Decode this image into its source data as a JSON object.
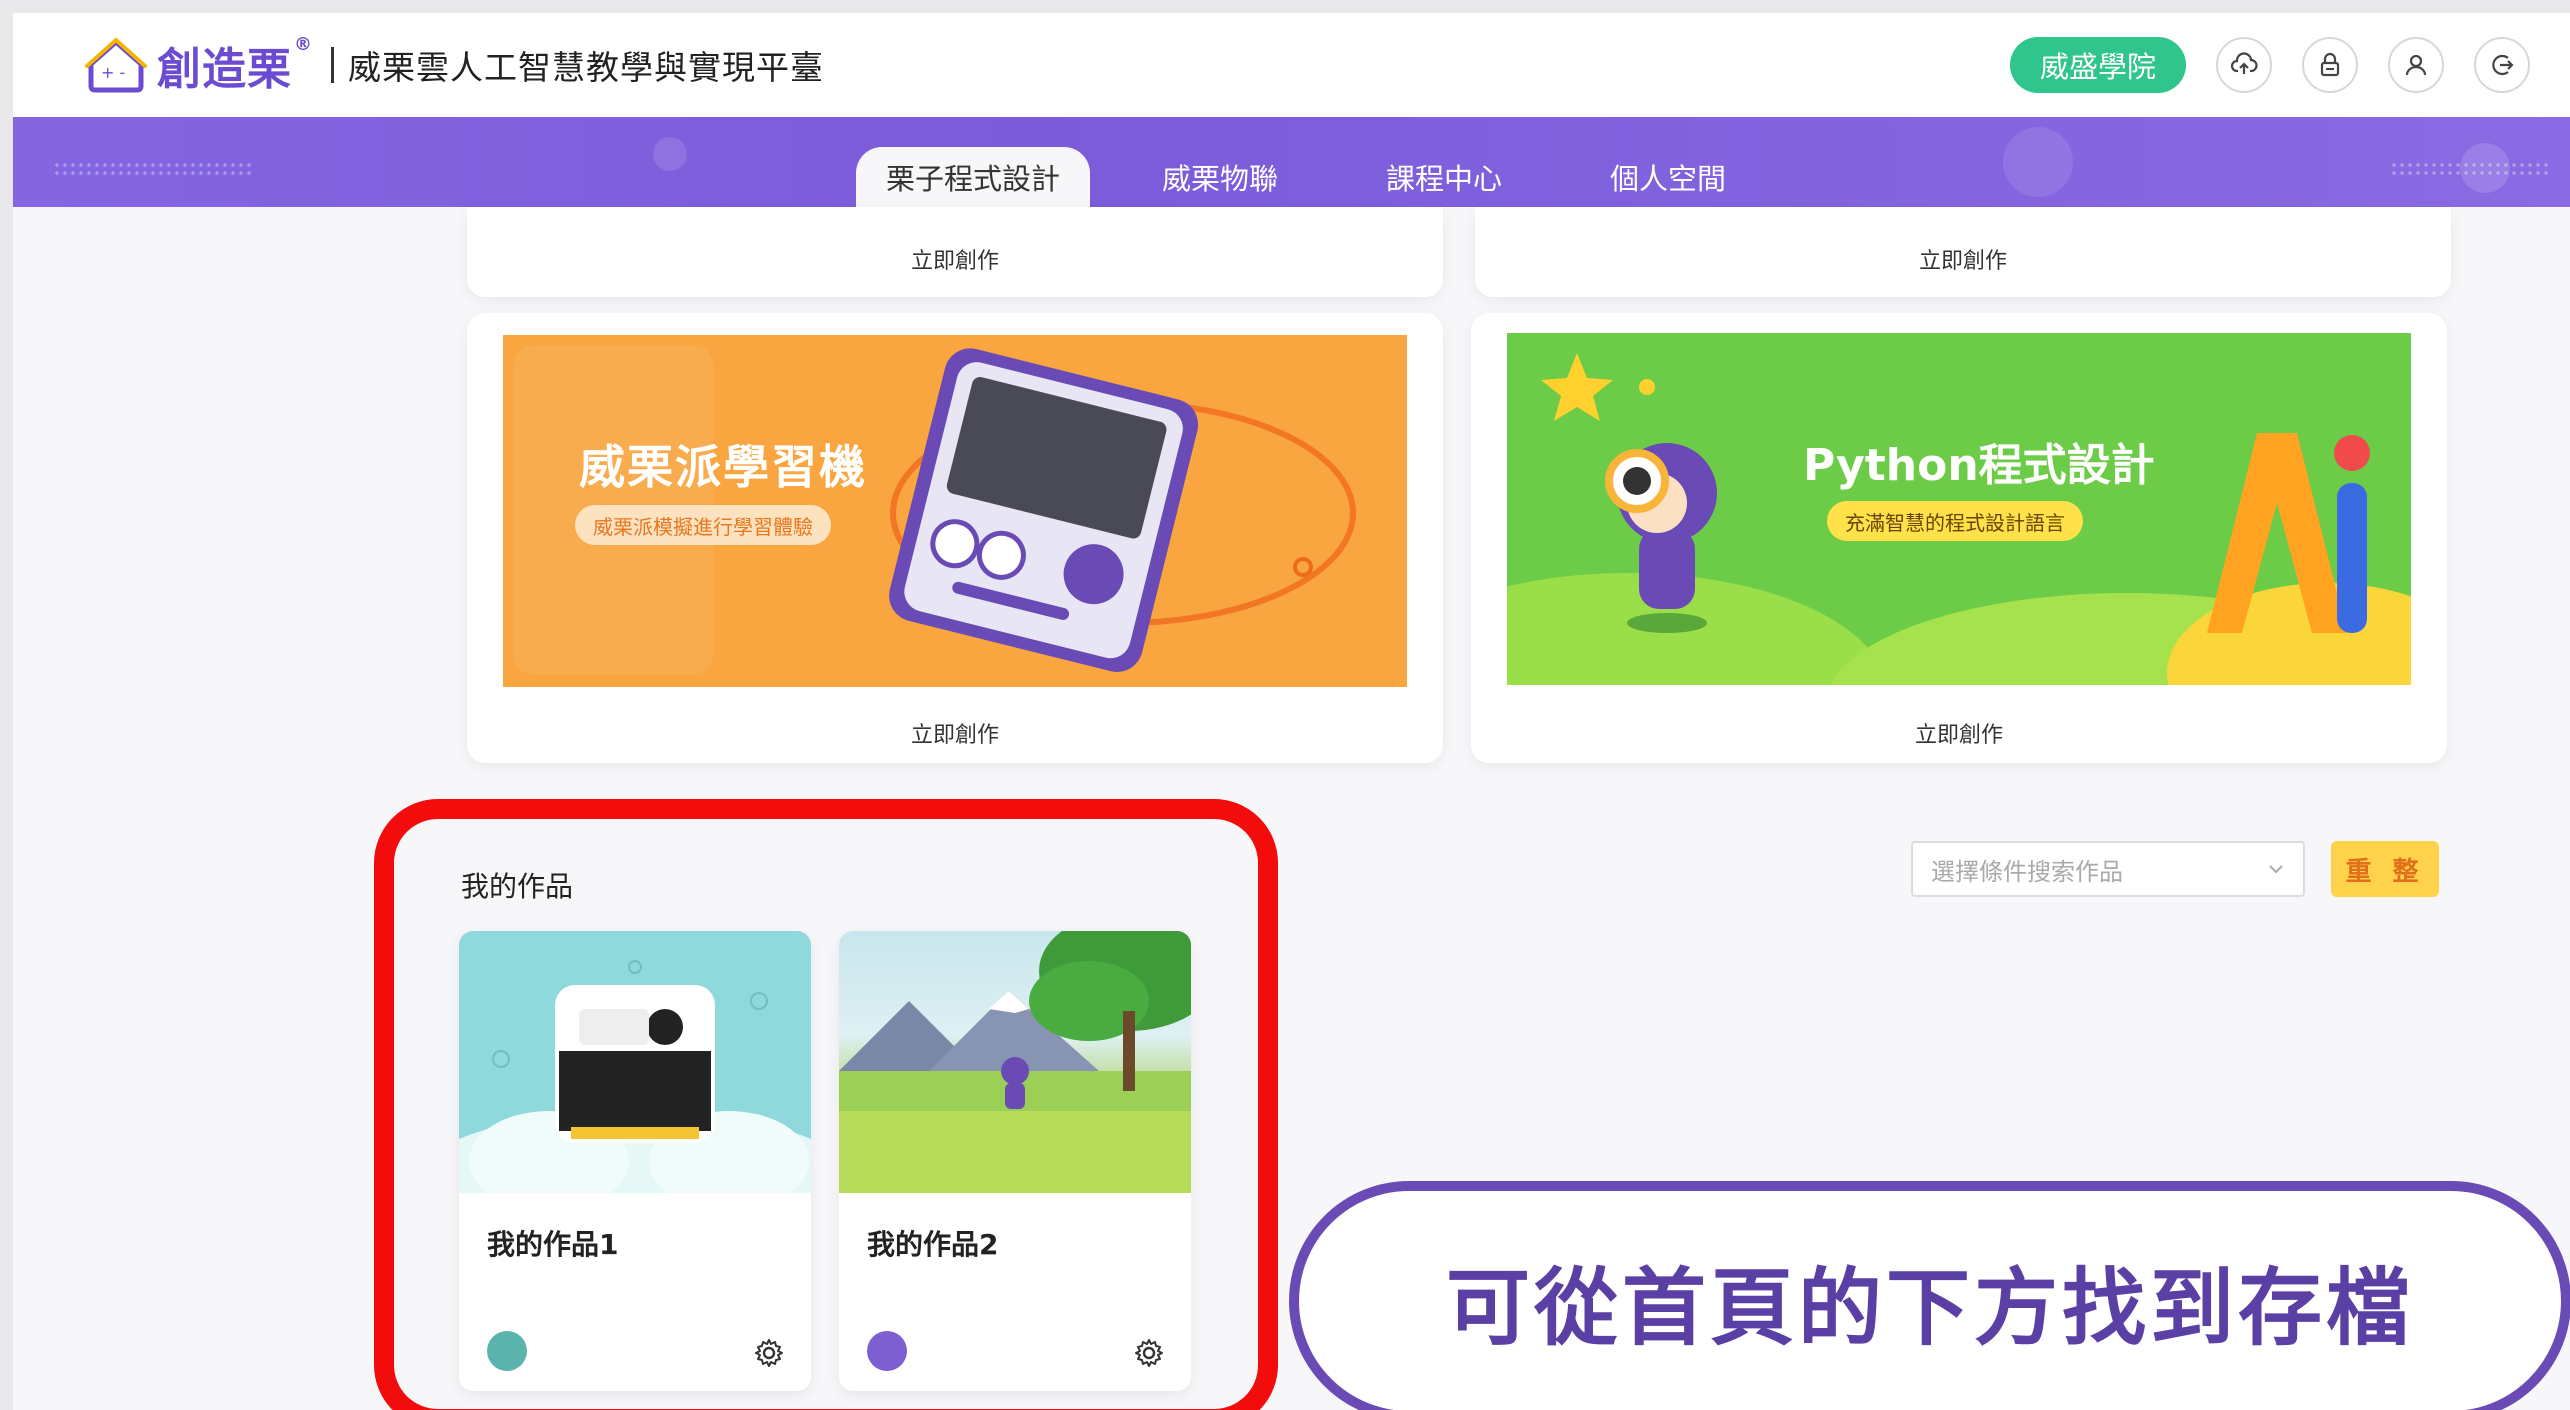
{
  "header": {
    "brand_name": "創造栗",
    "brand_mark": "®",
    "platform_title": "威栗雲人工智慧教學與實現平臺",
    "academy_button": "威盛學院",
    "icons": [
      "cloud-upload-icon",
      "lock-icon",
      "user-icon",
      "logout-icon"
    ]
  },
  "nav": {
    "tabs": [
      {
        "label": "栗子程式設計",
        "active": true
      },
      {
        "label": "威栗物聯",
        "active": false
      },
      {
        "label": "課程中心",
        "active": false
      },
      {
        "label": "個人空間",
        "active": false
      }
    ]
  },
  "cards": {
    "top_left_cta": "立即創作",
    "top_right_cta": "立即創作",
    "orange": {
      "title": "威栗派學習機",
      "subtitle": "威栗派模擬進行學習體驗",
      "cta": "立即創作"
    },
    "green": {
      "title": "Python程式設計",
      "subtitle": "充滿智慧的程式設計語言",
      "cta": "立即創作"
    }
  },
  "works": {
    "section_title": "我的作品",
    "search_placeholder": "選擇條件搜索作品",
    "reset_button": "重 整",
    "items": [
      {
        "name": "我的作品1"
      },
      {
        "name": "我的作品2"
      }
    ]
  },
  "annotation": {
    "callout_text": "可從首頁的下方找到存檔",
    "highlight_color": "#f20c0c",
    "callout_color": "#6a4bb5"
  },
  "colors": {
    "brand_purple": "#7b5bd9",
    "academy_green": "#2fc58c",
    "reset_yellow": "#ffd24c"
  }
}
